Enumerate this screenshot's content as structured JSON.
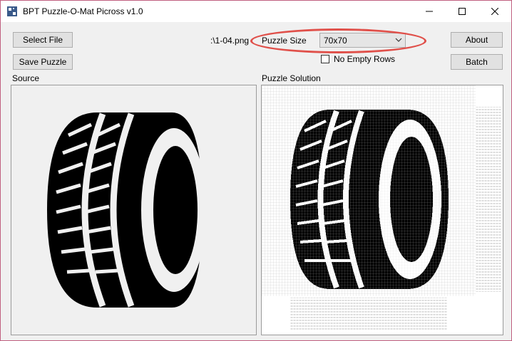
{
  "window": {
    "title": "BPT Puzzle-O-Mat Picross v1.0",
    "controls": [
      "minimize",
      "maximize",
      "close"
    ]
  },
  "toolbar": {
    "select_file_label": "Select File",
    "save_puzzle_label": "Save Puzzle",
    "file_name": ":\\1-04.png",
    "puzzle_size_label": "Puzzle Size",
    "puzzle_size_value": "70x70",
    "no_empty_rows_label": "No Empty Rows",
    "no_empty_rows_checked": false,
    "about_label": "About",
    "batch_label": "Batch"
  },
  "panels": {
    "source_label": "Source",
    "solution_label": "Puzzle Solution"
  },
  "colors": {
    "highlight_ring": "#e0504a",
    "window_border": "#c06080"
  }
}
